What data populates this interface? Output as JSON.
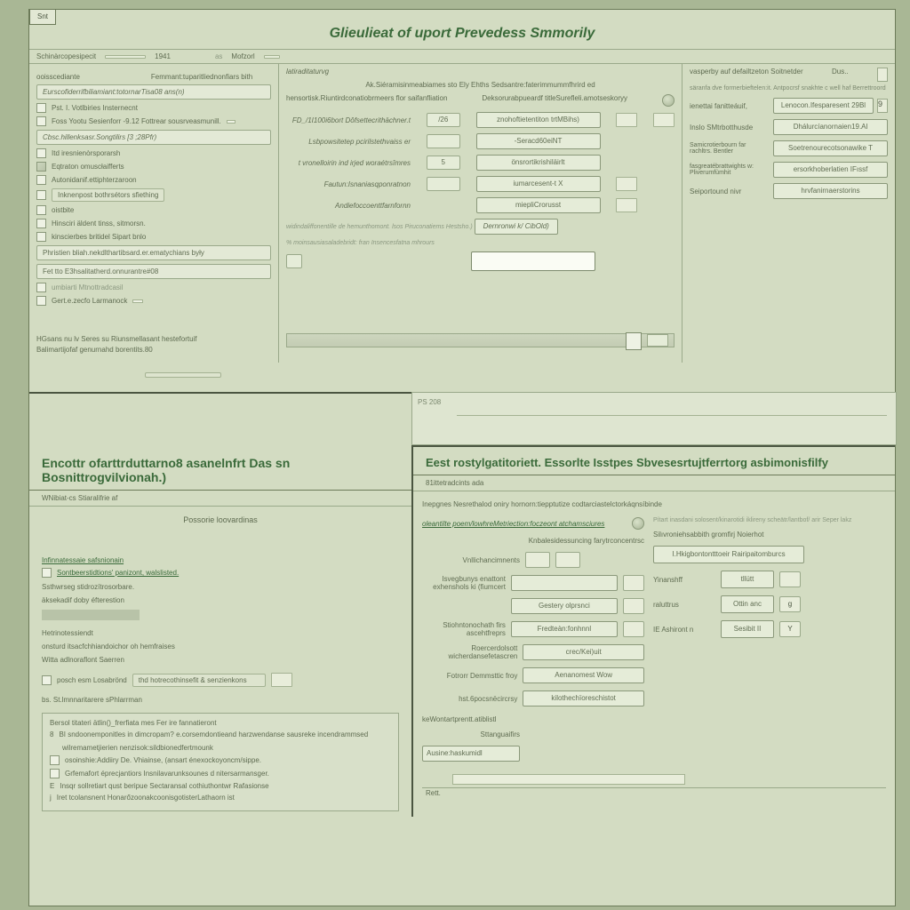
{
  "tab": "Snt",
  "mainTitle": "Glieulieat of uport Prevedess Smmorily",
  "topBar": {
    "left1": "Schinàrcopesipecit",
    "num1": "1941",
    "right1": "Mofzorl"
  },
  "leftPanel": {
    "hdr1": "ooisscediante",
    "hdr2": "Femmant:tuparitliednonfiars bith",
    "listItems": [
      "Eurscofiderrifbiliamiant:totornarTisa08 ans(n)",
      "Pst. I.   Votlbiries Insternecnt",
      "Foss    Yootu Sesienforr   -9.12     Fottrear sousrveasmunill.",
      "Cbsc.hillenksasr.Songtilirs [3 ;28Pfr)",
      "Itd iresnienòrsporarsh",
      "Eqtraton omuscłaifferts",
      "Autonidanif.ettiphterzaroon",
      "Inknenpost bothrsétors sfiething",
      "oistbite",
      "Hinsciri äldent tinss, sitmorsn.",
      "kinscierbes britidel Sipart bnlo",
      "Phristien bliah.nekdlthartibsard.er.ematychians były",
      "Fet tto E3hsalitatherd.onnurantre#08"
    ],
    "checkA": "umbiarti Mtnottradcasil",
    "checkB": "Gert.e.zecfo Larmanock",
    "foot1": "HGsans nu lv Seres su Riunsmellasant hestefortuif",
    "foot2": "Balimartijofaf genurnahd   borentits.80"
  },
  "centerPanel": {
    "secLabel": "latiraditaturvg",
    "subhead": "Ak.Siéramisinmeabiames sto Ely Ehths Sedsantre:faterimmummfhrird ed",
    "formHdrL": "hensortisk.Riuntirdconatiobrmeers flor saifanfliation",
    "formHdrR": "Deksorurabpueardf titleSurefleli.amotseskoryy",
    "rows": [
      {
        "label": "FD_/1I100i6bort Dôfsettecrithächner.t",
        "num": "/26",
        "val": "znohoftietentiton trtMBihs)"
      },
      {
        "label": "Lsbpowsitetep pcirilstethvaiss er",
        "num": "",
        "val": "-Seracd60eiNT"
      },
      {
        "label": "t vronelloirin ind irjed woraétrsîmres",
        "num": "5",
        "val": "önsrortikrishiläirlt"
      },
      {
        "label": "Fautun:Isnaniasqponratnon",
        "num": "",
        "val": "iumarcesent-t X"
      },
      {
        "label": "Andiefoccoenttfarnfornn",
        "num": "",
        "val": "miepliCrorusst"
      }
    ],
    "note1": "widindaliffonentille de hemunthomont. lsos Piruconatiems Hestsho.)",
    "note2": "%  moinsausiasaladebridt: fran Insencesfatna mhrours",
    "longVal": "Dernronwi k/ CibOld)"
  },
  "rightPanel": {
    "topL": "vasperby auf defailtzeton  Soitnetder",
    "topR": "Dus..",
    "sub": "säranfa dve formerbieftelen:it. Antpocrsf snakhte c   well haf  Berrettroord",
    "kv": [
      {
        "label": "ienettai fanitteáuif,",
        "val": "Lenocon.Ifesparesent 29Bl",
        "btn": "9"
      },
      {
        "label": "Inslo  SMtrbotthusde",
        "val": "Dhálurcíanornaien19.Al"
      },
      {
        "label": "Samicrotierbourn far rachltrs. Bentler",
        "val": "Soetrenourecotsonawike T"
      },
      {
        "label": "fasgreatébrattwights w:    Pliverumfùmhit",
        "val": "ersorkhoberlatien IFıssf"
      },
      {
        "label": "Seiportound  nivr",
        "val": "hrvfanirnaerstorins"
      }
    ]
  },
  "lowerLeft": {
    "title": "Encottr ofarttrduttarno8 asanelnfrt Das sn Bosnittrogvilvionah.)",
    "band": "WNibiat-cs Stiaralifrie af",
    "centered": "Possorie loovardinas",
    "links": [
      "Infinnatessaie safsnionain",
      "Sontbeerstidtions' panizont, walslisted."
    ],
    "plain": [
      "Ssthwrseg stidrozítrosorbare.",
      "äksekadif doby éfterestion"
    ],
    "gLabel": "Hetrinotessiendt",
    "gLines": [
      "onsturd itsacfchhiandoichor oh hemfraises",
      "Witta adlnoraflont Saerren"
    ],
    "comboLabel": "posch esm Losabrönd",
    "comboVal": "thd hotrecothinsefit & senzienkons",
    "bulletHead": "bs.   St.lmnnaritarere sPhlarrman",
    "groupTitle": "Bersol titateri ätlin()_frerfiata mes   Fer ire fannatieront",
    "bullets": [
      "BI sndoonemponitles in dimcropam? e.corsemdontieand harzwendanse sausreke incendrammsed",
      "wilremametjierien nenzisok:sildbionedfertmounk",
      "osoinshie:Addiiry De. Vhiainse, (ansart  énexockoyoncm/sippe.",
      "Grfemafort éprecjantiors Insnilavarunksounes d nitersarmansger.",
      "Insqr sollretiart qust beripue Sectaransal cothiuthontwr Rafasionse",
      "Iret tcolansnent HonarőzoonakcoonisgotisterLathaorn ist"
    ]
  },
  "lowerRight": {
    "title": "Eest rostylgatitoriett.  Essorlte Isstpes Sbvesesrtujtferrtorg asbimonisfilfy",
    "band": "81ittetradcints ada",
    "sub": "Inepgnes Nesrethalod oniry hornorn:tiepptutize codtarciastelctorkáqnsíbinde",
    "left": {
      "link": "oleantilte poem/lowhreMetriection:foczeont atchamsciures",
      "hdr": "Knbalesidessuncing farytrconcentrsc",
      "rows": [
        {
          "label": "Vnllichancimnents",
          "val": ""
        },
        {
          "label": "Isvegbunys enattont exhenshols ki (fiumcert",
          "val2": "Gestery olprsnci"
        },
        {
          "label": "Stiohntonochath firs ascehtfreprs",
          "val2": "Fredteàn:fonhnnl"
        },
        {
          "label": "Roercerdolsott wicherdansefetascren",
          "val2": "crec/Kei)uit"
        },
        {
          "label": "Fotrorr Demmsttic froy",
          "val2": "Aenanomest Wow"
        },
        {
          "label": "hst.6pocsnëcircrsy",
          "val2": "kilothechïoreschistot"
        }
      ],
      "footLabel": "keWontartprentt.atiblistl",
      "footBtn": "Sttanguaifirs",
      "footBtn2": "Ausine:haskumidl"
    },
    "right": {
      "note": "Pítart inasdani  solosent/kinarotidi  iklireny scheätr/lantbof/ arir Seper  lakz",
      "hdr": "Silıvroniehsabbith gromfirj    Noierhot",
      "kv": [
        {
          "label": "",
          "val": "I.Hkigbontontttoeir  Rairipaitomburcs"
        },
        {
          "label": "Yinanshff",
          "val": "tllütt",
          "sm": ""
        },
        {
          "label": "raluttrus",
          "val": "Ottin anc",
          "sm": "g"
        },
        {
          "label": "IE Ashiront n",
          "val": "Sesibit II",
          "sm": "Y"
        }
      ]
    },
    "bottomLabel": "Rett."
  }
}
